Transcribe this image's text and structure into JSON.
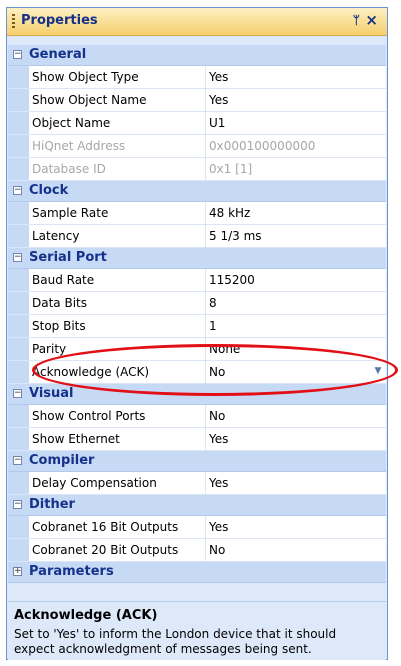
{
  "panel": {
    "title": "Properties",
    "pin_glyph": "ᛘ",
    "close_glyph": "×",
    "icons": {
      "grip": "grip-icon",
      "pin": "pin-icon",
      "close": "close-icon",
      "dropdown": "chevron-down-icon"
    }
  },
  "categories": [
    {
      "label": "General",
      "expanded": true,
      "rows": [
        {
          "name": "Show Object Type",
          "value": "Yes",
          "disabled": false
        },
        {
          "name": "Show Object Name",
          "value": "Yes",
          "disabled": false
        },
        {
          "name": "Object Name",
          "value": "U1",
          "disabled": false
        },
        {
          "name": "HiQnet Address",
          "value": "0x000100000000",
          "disabled": true
        },
        {
          "name": "Database ID",
          "value": "0x1 [1]",
          "disabled": true
        }
      ]
    },
    {
      "label": "Clock",
      "expanded": true,
      "rows": [
        {
          "name": "Sample Rate",
          "value": "48 kHz",
          "disabled": false
        },
        {
          "name": "Latency",
          "value": "5 1/3 ms",
          "disabled": false
        }
      ]
    },
    {
      "label": "Serial Port",
      "expanded": true,
      "rows": [
        {
          "name": "Baud Rate",
          "value": "115200",
          "disabled": false
        },
        {
          "name": "Data Bits",
          "value": "8",
          "disabled": false
        },
        {
          "name": "Stop Bits",
          "value": "1",
          "disabled": false
        },
        {
          "name": "Parity",
          "value": "None",
          "disabled": false
        },
        {
          "name": "Acknowledge (ACK)",
          "value": "No",
          "disabled": false,
          "selected": true
        }
      ]
    },
    {
      "label": "Visual",
      "expanded": true,
      "rows": [
        {
          "name": "Show Control Ports",
          "value": "No",
          "disabled": false
        },
        {
          "name": "Show Ethernet",
          "value": "Yes",
          "disabled": false
        }
      ]
    },
    {
      "label": "Compiler",
      "expanded": true,
      "rows": [
        {
          "name": "Delay Compensation",
          "value": "Yes",
          "disabled": false
        }
      ]
    },
    {
      "label": "Dither",
      "expanded": true,
      "rows": [
        {
          "name": "Cobranet 16 Bit Outputs",
          "value": "Yes",
          "disabled": false
        },
        {
          "name": "Cobranet 20 Bit Outputs",
          "value": "No",
          "disabled": false
        }
      ]
    },
    {
      "label": "Parameters",
      "expanded": false,
      "rows": []
    }
  ],
  "description": {
    "title": "Acknowledge (ACK)",
    "text": "Set to 'Yes' to inform the London device that it should expect acknowledgment of messages being sent."
  },
  "colors": {
    "title_bar": "#f6cf6c",
    "category_bg": "#c7daf5",
    "highlight_ellipse": "#e20f16"
  }
}
